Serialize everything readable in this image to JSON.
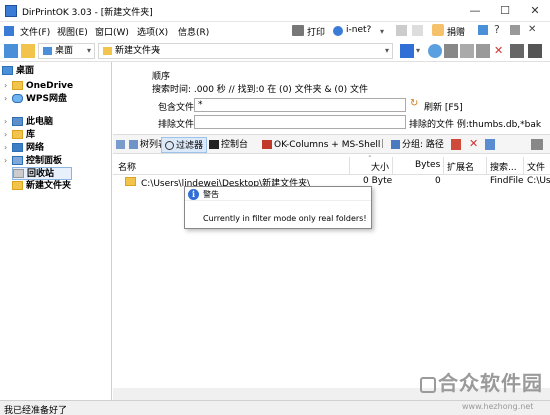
{
  "window": {
    "title": "DirPrintOK 3.03 - [新建文件夹]",
    "minimize": "—",
    "maximize": "☐",
    "close": "✕"
  },
  "menu": {
    "items": [
      "文件(F)",
      "视图(E)",
      "窗口(W)",
      "选项(X)",
      "信息(R)"
    ],
    "print": "打印",
    "inet": "i-net?",
    "donate": "捐赠"
  },
  "toolbar": {
    "location_combo": "桌面",
    "folder_combo": "新建文件夹"
  },
  "sidebar": {
    "items": [
      {
        "label": "桌面",
        "level": 0,
        "icon": "desktop-icon",
        "expanded": true
      },
      {
        "label": "OneDrive",
        "level": 1,
        "icon": "folder-icon",
        "expanded": false
      },
      {
        "label": "WPS网盘",
        "level": 1,
        "icon": "cloud-icon",
        "expanded": false
      },
      {
        "label": "此电脑",
        "level": 1,
        "icon": "computer-icon",
        "expanded": false
      },
      {
        "label": "库",
        "level": 1,
        "icon": "folder-icon",
        "expanded": false
      },
      {
        "label": "网络",
        "level": 1,
        "icon": "network-icon",
        "expanded": false
      },
      {
        "label": "控制面板",
        "level": 1,
        "icon": "control-panel-icon",
        "expanded": false
      },
      {
        "label": "回收站",
        "level": 1,
        "icon": "recycle-bin-icon",
        "expanded": false
      },
      {
        "label": "新建文件夹",
        "level": 1,
        "icon": "folder-icon",
        "expanded": false
      }
    ]
  },
  "filter": {
    "section_label": "顺序",
    "search_time": "搜索时间: .000 秒 //  找到:0 在 (0) 文件夹 & (0) 文件",
    "include_label": "包含文件",
    "include_value": "*",
    "exclude_label": "排除文件",
    "exclude_value": "",
    "refresh_label": "刷新 [F5]",
    "exclude_example": "排除的文件 例:thumbs.db,*bak"
  },
  "tabs": {
    "tree": "树列表",
    "filter": "过滤器",
    "console": "控制台",
    "columns": "OK-Columns + MS-Shell",
    "group": "分组: 路径"
  },
  "table": {
    "headers": [
      "名称",
      "大小",
      "Bytes",
      "扩展名",
      "搜索...",
      "文件"
    ],
    "rows": [
      {
        "name": "C:\\Users\\lindewei\\Desktop\\新建文件夹\\",
        "size": "0 Byte",
        "bytes": "0",
        "ext": "",
        "search": "FindFile",
        "file": "C:\\Us"
      }
    ]
  },
  "dialog": {
    "title": "警告",
    "message": "Currently in filter mode only real folders!"
  },
  "status": {
    "text": "我已经准备好了"
  },
  "watermark": {
    "text": "合众软件园",
    "url": "www.hezhong.net"
  }
}
